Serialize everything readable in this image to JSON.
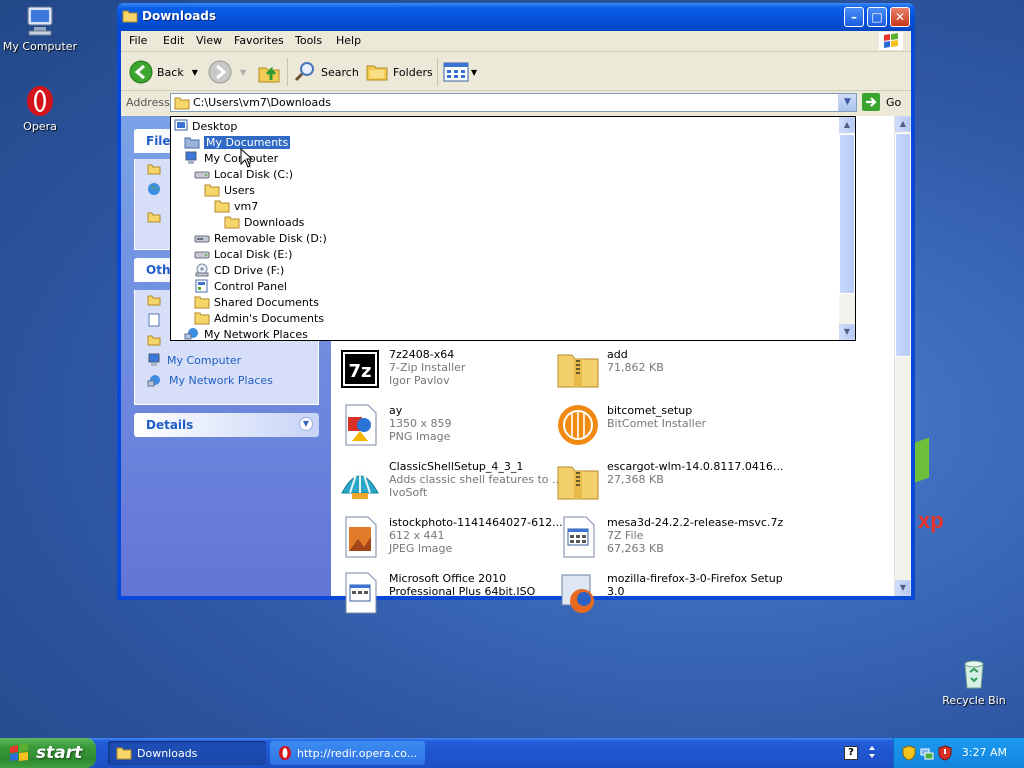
{
  "desktop": {
    "icons": [
      {
        "label": "My Computer"
      },
      {
        "label": "Opera"
      },
      {
        "label": "Recycle Bin"
      }
    ]
  },
  "window": {
    "title": "Downloads",
    "menu": [
      "File",
      "Edit",
      "View",
      "Favorites",
      "Tools",
      "Help"
    ],
    "toolbar": {
      "back": "Back",
      "search": "Search",
      "folders": "Folders"
    },
    "address": {
      "label": "Address",
      "value": "C:\\Users\\vm7\\Downloads",
      "go": "Go"
    },
    "tasks": {
      "file_header": "File",
      "other_header": "Othe",
      "other_links": [
        "My Computer",
        "My Network Places"
      ],
      "details_header": "Details"
    },
    "dropdown_items": [
      {
        "label": "Desktop",
        "icon": "desktop-icon"
      },
      {
        "label": "My Documents",
        "icon": "documents-icon",
        "selected": true
      },
      {
        "label": "My Computer",
        "icon": "computer-icon"
      },
      {
        "label": "Local Disk (C:)",
        "icon": "disk-icon"
      },
      {
        "label": "Users",
        "icon": "folder-icon"
      },
      {
        "label": "vm7",
        "icon": "folder-icon"
      },
      {
        "label": "Downloads",
        "icon": "folder-icon"
      },
      {
        "label": "Removable Disk (D:)",
        "icon": "removable-disk-icon"
      },
      {
        "label": "Local Disk (E:)",
        "icon": "disk-icon"
      },
      {
        "label": "CD Drive (F:)",
        "icon": "cd-drive-icon"
      },
      {
        "label": "Control Panel",
        "icon": "control-panel-icon"
      },
      {
        "label": "Shared Documents",
        "icon": "folder-icon"
      },
      {
        "label": "Admin's Documents",
        "icon": "folder-icon"
      },
      {
        "label": "My Network Places",
        "icon": "network-icon"
      }
    ],
    "files": [
      {
        "name": "7z2408-x64",
        "line1": "7-Zip Installer",
        "line2": "Igor Pavlov",
        "icon": "7zip-icon"
      },
      {
        "name": "add",
        "line1": "71,862 KB",
        "line2": "",
        "icon": "zip-folder-icon"
      },
      {
        "name": "ay",
        "line1": "1350 x 859",
        "line2": "PNG Image",
        "icon": "png-image-icon"
      },
      {
        "name": "bitcomet_setup",
        "line1": "BitComet Installer",
        "line2": "",
        "icon": "bitcomet-icon"
      },
      {
        "name": "ClassicShellSetup_4_3_1",
        "line1": "Adds classic shell features to ...",
        "line2": "IvoSoft",
        "icon": "classic-shell-icon"
      },
      {
        "name": "escargot-wlm-14.0.8117.0416...",
        "line1": "27,368 KB",
        "line2": "",
        "icon": "zip-folder-icon"
      },
      {
        "name": "istockphoto-1141464027-612...",
        "line1": "612 x 441",
        "line2": "JPEG Image",
        "icon": "jpeg-image-icon"
      },
      {
        "name": "mesa3d-24.2.2-release-msvc.7z",
        "line1": "7Z File",
        "line2": "67,263 KB",
        "icon": "7z-file-icon"
      },
      {
        "name": "Microsoft Office 2010",
        "line1": "Professional Plus 64bit.ISO",
        "line2": "",
        "icon": "iso-file-icon"
      },
      {
        "name": "mozilla-firefox-3-0-Firefox Setup",
        "line1": "3.0",
        "line2": "",
        "icon": "firefox-setup-icon"
      }
    ]
  },
  "taskbar": {
    "start": "start",
    "tasks": [
      {
        "label": "Downloads"
      },
      {
        "label": "http://redir.opera.co..."
      }
    ],
    "clock": "3:27 AM"
  }
}
